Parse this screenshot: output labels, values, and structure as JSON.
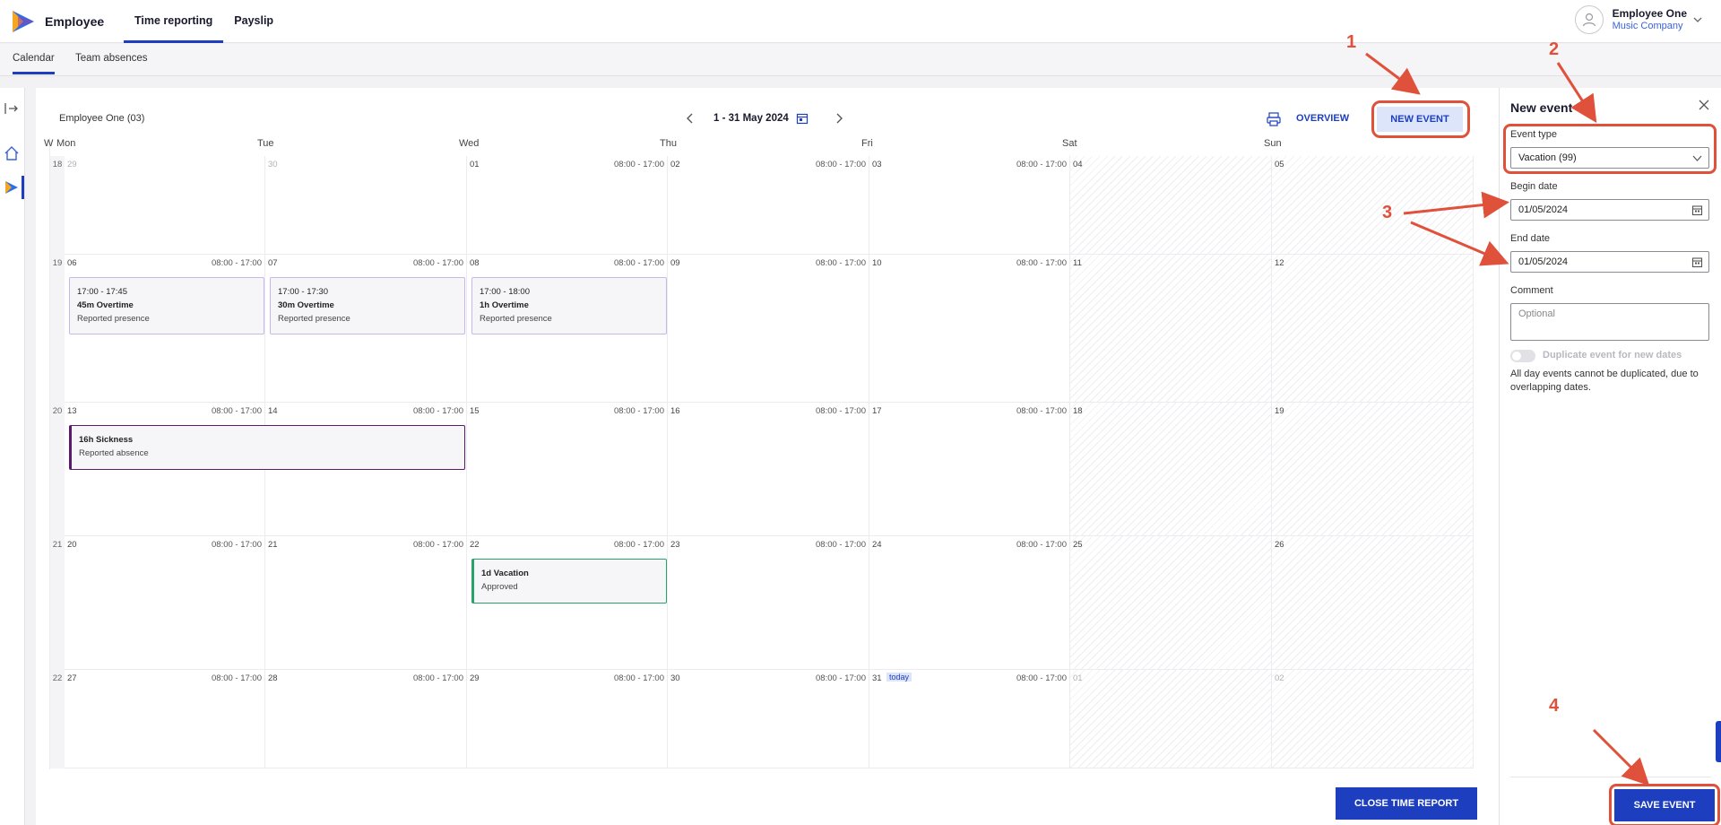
{
  "header": {
    "app_name": "Employee",
    "nav": [
      "Time reporting",
      "Payslip"
    ],
    "active_nav": "Time reporting",
    "user_name": "Employee One",
    "user_company": "Music Company"
  },
  "subnav": {
    "tabs": [
      "Calendar",
      "Team absences"
    ],
    "active": "Calendar"
  },
  "calendar": {
    "employee_label": "Employee One (03)",
    "date_range": "1 - 31 May 2024",
    "overview_label": "OVERVIEW",
    "new_event_label": "NEW EVENT",
    "week_header": "W",
    "day_headers": [
      "Mon",
      "Tue",
      "Wed",
      "Thu",
      "Fri",
      "Sat",
      "Sun"
    ],
    "weeks": [
      {
        "week": "18",
        "days": [
          {
            "d": "29",
            "other": true,
            "hrs": ""
          },
          {
            "d": "30",
            "other": true,
            "hrs": ""
          },
          {
            "d": "01",
            "hrs": "08:00 - 17:00"
          },
          {
            "d": "02",
            "hrs": "08:00 - 17:00"
          },
          {
            "d": "03",
            "hrs": "08:00 - 17:00"
          },
          {
            "d": "04",
            "hrs": ""
          },
          {
            "d": "05",
            "hrs": ""
          }
        ]
      },
      {
        "week": "19",
        "days": [
          {
            "d": "06",
            "hrs": "08:00 - 17:00"
          },
          {
            "d": "07",
            "hrs": "08:00 - 17:00"
          },
          {
            "d": "08",
            "hrs": "08:00 - 17:00"
          },
          {
            "d": "09",
            "hrs": "08:00 - 17:00"
          },
          {
            "d": "10",
            "hrs": "08:00 - 17:00"
          },
          {
            "d": "11",
            "hrs": ""
          },
          {
            "d": "12",
            "hrs": ""
          }
        ]
      },
      {
        "week": "20",
        "days": [
          {
            "d": "13",
            "hrs": "08:00 - 17:00"
          },
          {
            "d": "14",
            "hrs": "08:00 - 17:00"
          },
          {
            "d": "15",
            "hrs": "08:00 - 17:00"
          },
          {
            "d": "16",
            "hrs": "08:00 - 17:00"
          },
          {
            "d": "17",
            "hrs": "08:00 - 17:00"
          },
          {
            "d": "18",
            "hrs": ""
          },
          {
            "d": "19",
            "hrs": ""
          }
        ]
      },
      {
        "week": "21",
        "days": [
          {
            "d": "20",
            "hrs": "08:00 - 17:00"
          },
          {
            "d": "21",
            "hrs": "08:00 - 17:00"
          },
          {
            "d": "22",
            "hrs": "08:00 - 17:00"
          },
          {
            "d": "23",
            "hrs": "08:00 - 17:00"
          },
          {
            "d": "24",
            "hrs": "08:00 - 17:00"
          },
          {
            "d": "25",
            "hrs": ""
          },
          {
            "d": "26",
            "hrs": ""
          }
        ]
      },
      {
        "week": "22",
        "days": [
          {
            "d": "27",
            "hrs": "08:00 - 17:00"
          },
          {
            "d": "28",
            "hrs": "08:00 - 17:00"
          },
          {
            "d": "29",
            "hrs": "08:00 - 17:00"
          },
          {
            "d": "30",
            "hrs": "08:00 - 17:00"
          },
          {
            "d": "31",
            "hrs": "08:00 - 17:00",
            "today": "today"
          },
          {
            "d": "01",
            "other": true,
            "hrs": ""
          },
          {
            "d": "02",
            "other": true,
            "hrs": ""
          }
        ]
      }
    ],
    "events": [
      {
        "time": "17:00 - 17:45",
        "title": "45m Overtime",
        "status": "Reported presence"
      },
      {
        "time": "17:00 - 17:30",
        "title": "30m Overtime",
        "status": "Reported presence"
      },
      {
        "time": "17:00 - 18:00",
        "title": "1h Overtime",
        "status": "Reported presence"
      },
      {
        "time": "",
        "title": "16h Sickness",
        "status": "Reported absence"
      },
      {
        "time": "",
        "title": "1d Vacation",
        "status": "Approved"
      }
    ],
    "close_label": "CLOSE TIME REPORT"
  },
  "new_event": {
    "title": "New event",
    "event_type_label": "Event type",
    "event_type_value": "Vacation (99)",
    "begin_label": "Begin date",
    "begin_value": "01/05/2024",
    "end_label": "End date",
    "end_value": "01/05/2024",
    "comment_label": "Comment",
    "comment_placeholder": "Optional",
    "duplicate_label": "Duplicate event for new dates",
    "note": "All day events cannot be duplicated, due to overlapping dates.",
    "save_label": "SAVE EVENT"
  },
  "annotations": [
    "1",
    "2",
    "3",
    "4"
  ],
  "colors": {
    "accent": "#1d3fbf",
    "annotation": "#e0513b",
    "overtime_border": "#c7b8ec",
    "sickness_border": "#5a1a6a",
    "vacation_border": "#27a36b"
  }
}
